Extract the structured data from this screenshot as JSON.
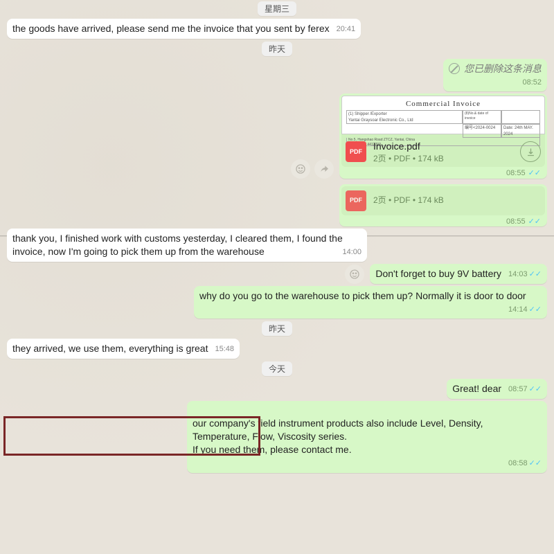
{
  "dates": {
    "wed": "星期三",
    "yesterday": "昨天",
    "today": "今天"
  },
  "msgs": {
    "m1": {
      "text": "the goods have arrived, please send me the invoice that you sent by ferex",
      "time": "20:41"
    },
    "deleted": {
      "text": "您已删除这条消息",
      "time": "08:52"
    },
    "invoice": {
      "previewTitle": "Commercial  Invoice",
      "shipper": "(1) Shipper /Exporter\nYantai Graysoar Electronic Co., Ltd",
      "addr": "No.5, Hangshao Road ZTCZ, Yantai, China\nTel:+86 535 4412793",
      "noLabel": "(8)No.& date of invoice",
      "noVal": "编号<2024-0024",
      "dateVal": "Date: 24th MAY. 2024",
      "name": "Invoice.pdf",
      "sub": "2页 • PDF • 174 kB",
      "time": "08:55"
    },
    "dupe": {
      "sub": "2页 • PDF • 174 kB",
      "time": "08:55"
    },
    "m2": {
      "text": "thank you, I finished work with customs yesterday, I cleared them, I found the invoice, now I'm going to pick them up from the warehouse",
      "time": "14:00"
    },
    "m3": {
      "text": "Don't forget to buy 9V battery",
      "time": "14:03"
    },
    "m4": {
      "text": "why do you go to the warehouse to pick them up?  Normally it is door to door",
      "time": "14:14"
    },
    "m5": {
      "text": "they arrived, we use them, everything is great",
      "time": "15:48"
    },
    "m6": {
      "text": "Great! dear",
      "time": "08:57"
    },
    "m7": {
      "text": "our company's field instrument products also include Level, Density, Temperature, Flow, Viscosity series.\nIf you need them, please contact me.",
      "time": "08:58"
    }
  },
  "ticks": "✓✓"
}
